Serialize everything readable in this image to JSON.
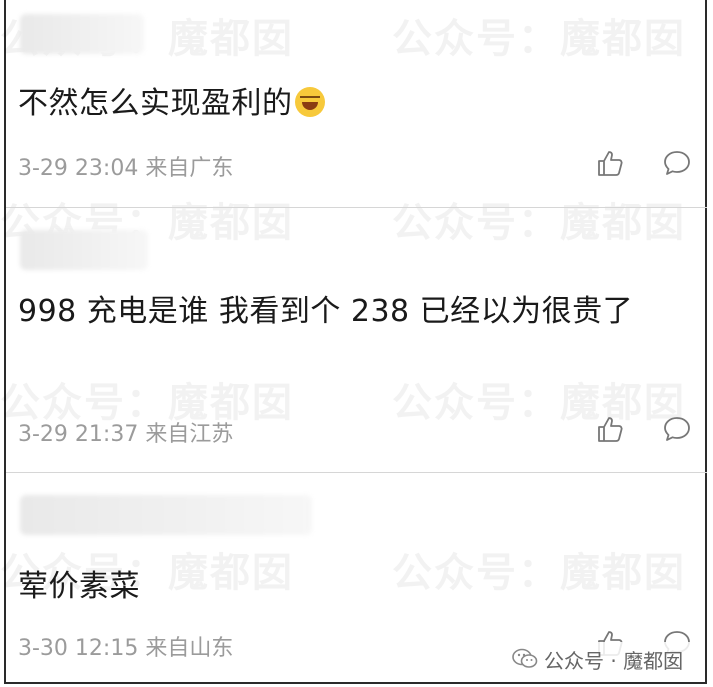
{
  "watermark_text": "公众号：魔都囡",
  "comments": [
    {
      "text": "不然怎么实现盈利的",
      "emoji": "tears-of-joy-emoji",
      "date": "3-29 23:04",
      "location": "来自广东"
    },
    {
      "text": "998 充电是谁 我看到个 238 已经以为很贵了",
      "date": "3-29 21:37",
      "location": "来自江苏"
    },
    {
      "text": "荤价素菜",
      "date": "3-30 12:15",
      "location": "来自山东"
    }
  ],
  "badge": {
    "text": "公众号 · 魔都囡",
    "icon": "wechat-icon"
  },
  "icons": {
    "like": "thumbs-up-icon",
    "reply": "comment-icon"
  },
  "colors": {
    "text": "#1a1a1a",
    "meta": "#9b9b9b",
    "divider": "#d6d6d6"
  }
}
